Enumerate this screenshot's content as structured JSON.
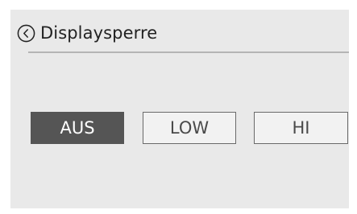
{
  "header": {
    "title": "Displaysperre",
    "back_icon": "back-circle-icon"
  },
  "options": [
    {
      "label": "AUS",
      "selected": true
    },
    {
      "label": "LOW",
      "selected": false
    },
    {
      "label": "HI",
      "selected": false
    }
  ],
  "colors": {
    "background": "#e9e9e9",
    "selected_fill": "#555555",
    "border": "#6a6a6a",
    "divider": "#b5b5b5"
  }
}
